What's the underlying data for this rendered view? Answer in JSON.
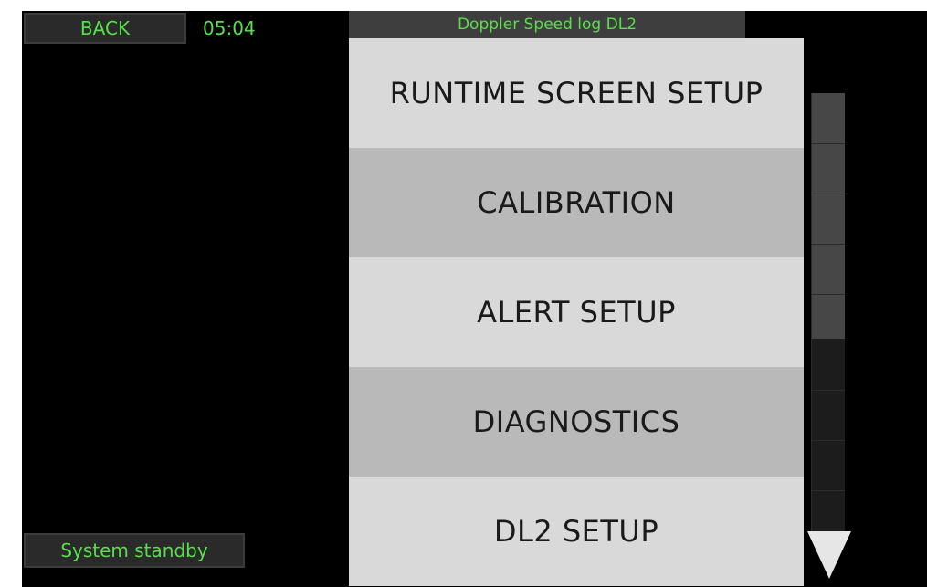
{
  "header": {
    "back_label": "BACK",
    "clock": "05:04",
    "title": "Doppler Speed log DL2"
  },
  "menu": {
    "items": [
      {
        "label": "RUNTIME SCREEN SETUP"
      },
      {
        "label": "CALIBRATION"
      },
      {
        "label": "ALERT SETUP"
      },
      {
        "label": "DIAGNOSTICS"
      },
      {
        "label": "DL2 SETUP"
      }
    ]
  },
  "scrollbar": {
    "position_fraction": 0.0,
    "visible_fraction": 0.56,
    "icon": "triangle-down-icon"
  },
  "status": {
    "text": "System standby"
  },
  "colors": {
    "accent_text": "#58e04a",
    "background": "#000000",
    "menu_light": "#d9d9d9",
    "menu_dark": "#b9b9b9"
  }
}
